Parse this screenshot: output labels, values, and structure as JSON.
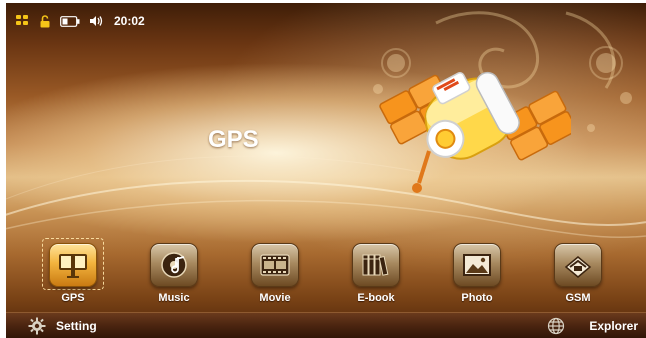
{
  "status_bar": {
    "time": "20:02",
    "icons": [
      "apps-grid-icon",
      "unlock-icon",
      "battery-icon",
      "volume-icon"
    ]
  },
  "main": {
    "title": "GPS"
  },
  "dock": {
    "selected": "GPS",
    "apps": [
      {
        "label": "GPS",
        "icon": "gps-icon"
      },
      {
        "label": "Music",
        "icon": "music-disc-icon"
      },
      {
        "label": "Movie",
        "icon": "film-icon"
      },
      {
        "label": "E-book",
        "icon": "books-icon"
      },
      {
        "label": "Photo",
        "icon": "picture-icon"
      },
      {
        "label": "GSM",
        "icon": "phone-card-icon"
      }
    ]
  },
  "bottom_bar": {
    "setting_label": "Setting",
    "explorer_label": "Explorer"
  },
  "colors": {
    "accent": "#f3b43e",
    "background_dark": "#4a2208",
    "background_light": "#e2bd86"
  }
}
